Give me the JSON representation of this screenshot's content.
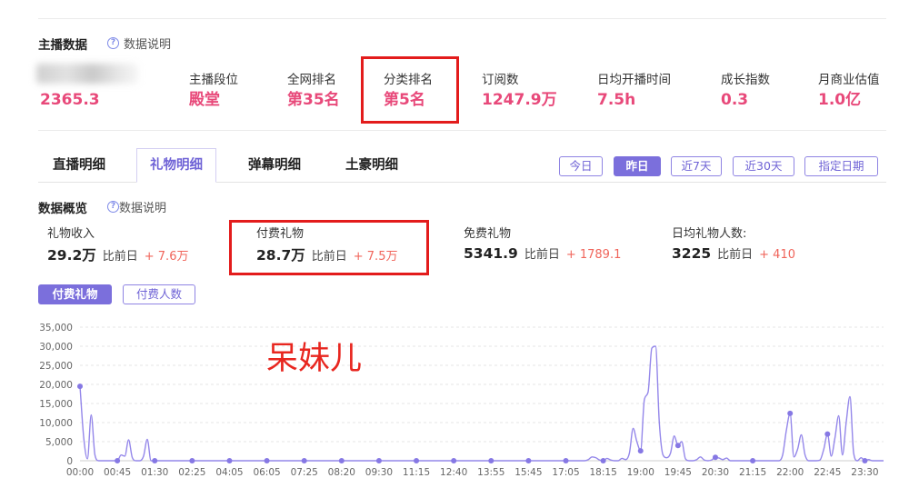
{
  "colors": {
    "accent": "#7b6fdc",
    "value": "#e8497a",
    "delta": "#f0655b",
    "highlight_box": "#e31c1c",
    "annotation": "#e8261f"
  },
  "anchor_section": {
    "title": "主播数据",
    "help_icon": "question-circle-icon",
    "help_label": "数据说明",
    "first_stat_value": "2365.3",
    "stats": [
      {
        "label": "主播段位",
        "value": "殿堂"
      },
      {
        "label": "全网排名",
        "value": "第35名"
      },
      {
        "label": "分类排名",
        "value": "第5名"
      },
      {
        "label": "订阅数",
        "value": "1247.9万"
      },
      {
        "label": "日均开播时间",
        "value": "7.5h"
      },
      {
        "label": "成长指数",
        "value": "0.3"
      },
      {
        "label": "月商业估值",
        "value": "1.0亿"
      }
    ]
  },
  "tabs": [
    {
      "label": "直播明细",
      "active": false
    },
    {
      "label": "礼物明细",
      "active": true
    },
    {
      "label": "弹幕明细",
      "active": false
    },
    {
      "label": "土豪明细",
      "active": false
    }
  ],
  "date_filters": [
    {
      "label": "今日",
      "active": false
    },
    {
      "label": "昨日",
      "active": true
    },
    {
      "label": "近7天",
      "active": false
    },
    {
      "label": "近30天",
      "active": false
    },
    {
      "label": "指定日期",
      "active": false
    }
  ],
  "overview": {
    "title": "数据概览",
    "help_icon": "question-circle-icon",
    "help_label": "数据说明",
    "compare_label": "比前日",
    "stats": [
      {
        "label": "礼物收入",
        "value": "29.2万",
        "delta": "+ 7.6万"
      },
      {
        "label": "付费礼物",
        "value": "28.7万",
        "delta": "+ 7.5万"
      },
      {
        "label": "免费礼物",
        "value": "5341.9",
        "delta": "+ 1789.1"
      },
      {
        "label": "日均礼物人数:",
        "value": "3225",
        "delta": "+ 410"
      }
    ]
  },
  "chart_toggles": [
    {
      "label": "付费礼物",
      "active": true
    },
    {
      "label": "付费人数",
      "active": false
    }
  ],
  "annotation": {
    "text": "呆妹儿"
  },
  "chart_data": {
    "type": "line",
    "smooth": true,
    "grid": true,
    "ylim": [
      0,
      35000
    ],
    "y_ticks": [
      {
        "value": 0,
        "label": "0"
      },
      {
        "value": 5000,
        "label": "5,000"
      },
      {
        "value": 10000,
        "label": "10,000"
      },
      {
        "value": 15000,
        "label": "15,000"
      },
      {
        "value": 20000,
        "label": "20,000"
      },
      {
        "value": 25000,
        "label": "25,000"
      },
      {
        "value": 30000,
        "label": "30,000"
      },
      {
        "value": 35000,
        "label": "35,000"
      }
    ],
    "x_ticks": [
      "00:00",
      "00:45",
      "01:30",
      "02:25",
      "04:05",
      "06:05",
      "07:25",
      "08:20",
      "09:30",
      "11:15",
      "12:40",
      "13:55",
      "15:45",
      "17:05",
      "18:15",
      "19:00",
      "19:45",
      "20:30",
      "21:15",
      "22:00",
      "22:45",
      "23:30"
    ],
    "series": [
      {
        "color": "#9487ea",
        "values": [
          19500,
          6000,
          500,
          12000,
          1500,
          0,
          0,
          0,
          0,
          0,
          0,
          1500,
          1200,
          5500,
          800,
          0,
          0,
          1200,
          5600,
          0,
          0,
          0,
          0,
          0,
          0,
          0,
          0,
          0,
          0,
          0,
          0,
          0,
          0,
          0,
          0,
          0,
          0,
          0,
          0,
          0,
          0,
          0,
          0,
          0,
          0,
          0,
          0,
          0,
          0,
          0,
          0,
          0,
          0,
          0,
          0,
          0,
          0,
          0,
          0,
          0,
          0,
          0,
          0,
          0,
          0,
          0,
          0,
          0,
          0,
          0,
          0,
          0,
          0,
          0,
          0,
          0,
          0,
          0,
          0,
          0,
          0,
          0,
          0,
          0,
          0,
          0,
          0,
          0,
          0,
          0,
          0,
          0,
          0,
          0,
          0,
          0,
          0,
          0,
          0,
          0,
          0,
          0,
          0,
          0,
          0,
          0,
          0,
          0,
          0,
          0,
          0,
          0,
          0,
          0,
          0,
          0,
          0,
          0,
          0,
          0,
          0,
          0,
          0,
          0,
          0,
          0,
          0,
          0,
          0,
          0,
          0,
          0,
          0,
          0,
          0,
          0,
          300,
          1000,
          800,
          200,
          0,
          600,
          200,
          0,
          0,
          600,
          300,
          2000,
          8500,
          5000,
          2600,
          16000,
          18000,
          29500,
          30000,
          10000,
          1500,
          800,
          2000,
          6500,
          4000,
          5000,
          500,
          0,
          0,
          300,
          1000,
          200,
          0,
          200,
          900,
          700,
          300,
          700,
          0,
          0,
          0,
          0,
          0,
          0,
          0,
          0,
          0,
          0,
          0,
          0,
          0,
          0,
          1500,
          8000,
          12400,
          1000,
          3000,
          6800,
          1500,
          0,
          0,
          0,
          200,
          3000,
          7000,
          1200,
          6000,
          11800,
          1500,
          10000,
          16800,
          2000,
          0,
          800,
          0,
          300,
          0,
          0,
          0,
          0
        ]
      }
    ]
  }
}
